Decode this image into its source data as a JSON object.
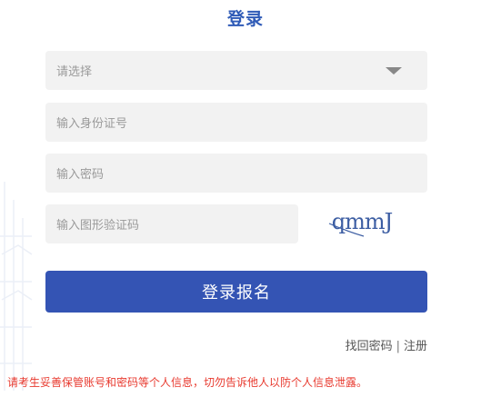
{
  "title": "登录",
  "form": {
    "select_placeholder": "请选择",
    "id_placeholder": "输入身份证号",
    "password_placeholder": "输入密码",
    "captcha_placeholder": "输入图形验证码",
    "captcha_text": "qmmJ"
  },
  "login_button": "登录报名",
  "links": {
    "find_password": "找回密码",
    "separator": "|",
    "register": "注册"
  },
  "notice": "请考生妥善保管账号和密码等个人信息，切勿告诉他人以防个人信息泄露。",
  "colors": {
    "accent": "#3454b4",
    "title": "#2f5bb7",
    "warning": "#e83a2f"
  }
}
